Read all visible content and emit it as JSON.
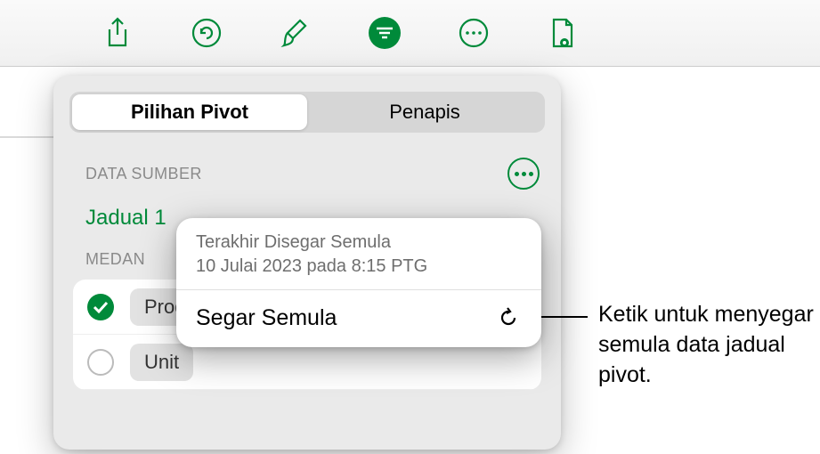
{
  "toolbar": {
    "icons": [
      "share-icon",
      "undo-icon",
      "brush-icon",
      "organize-icon",
      "more-icon",
      "document-view-icon"
    ]
  },
  "popover": {
    "tabs": {
      "pivot": "Pilihan Pivot",
      "filters": "Penapis"
    },
    "source_section_title": "DATA SUMBER",
    "table_name": "Jadual 1",
    "fields_section_title": "MEDAN",
    "fields": [
      {
        "label": "Produk",
        "checked": true
      },
      {
        "label": "Unit",
        "checked": false
      }
    ]
  },
  "refresh_card": {
    "last_refreshed_label": "Terakhir Disegar Semula",
    "last_refreshed_value": "10 Julai 2023 pada 8:15 PTG",
    "refresh_label": "Segar Semula"
  },
  "callout": {
    "text": "Ketik untuk menyegar semula data jadual pivot."
  },
  "colors": {
    "accent": "#008a3a"
  }
}
